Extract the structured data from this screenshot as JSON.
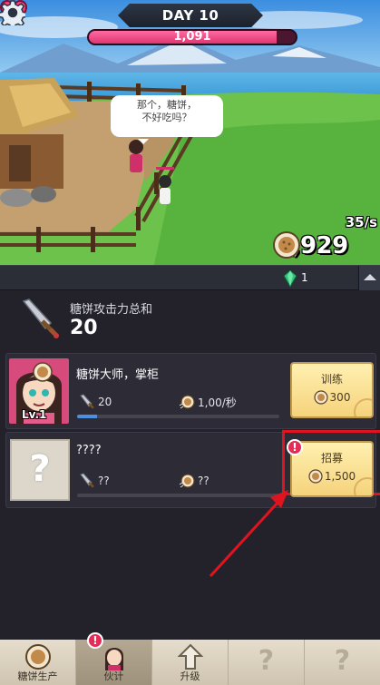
{
  "header": {
    "day": "DAY 10",
    "hp_value": "1,091",
    "hp_fraction": 0.91
  },
  "scene": {
    "speech": [
      "那个，糖饼，",
      "不好吃吗？"
    ],
    "rate": "35/s",
    "money": "3,929"
  },
  "gems": {
    "count": "1"
  },
  "total_attack": {
    "label": "糖饼攻击力总和",
    "value": "20"
  },
  "partners": [
    {
      "name": "糖饼大师，掌柜",
      "level": "Lv.1",
      "attack": "20",
      "rate": "1,00/秒",
      "progress": 0.1,
      "button_label": "训练",
      "button_cost": "300"
    },
    {
      "name": "????",
      "unknown_symbol": "?",
      "attack": "??",
      "rate": "??",
      "progress": 0,
      "button_label": "招募",
      "button_cost": "1,500",
      "alert": "!"
    }
  ],
  "nav": {
    "tabs": [
      {
        "label": "糖饼生产",
        "icon": "cake-icon"
      },
      {
        "label": "伙计",
        "icon": "partner-icon",
        "alert": "!"
      },
      {
        "label": "升级",
        "icon": "upgrade-arrow-icon"
      },
      {
        "label": "",
        "icon": "locked-icon",
        "symbol": "?"
      },
      {
        "label": "",
        "icon": "locked-icon",
        "symbol": "?"
      }
    ]
  },
  "colors": {
    "hp_fill": "#e03672",
    "progress": "#4c8fe0",
    "button": "#f5d37c",
    "highlight": "#e0141e",
    "gem": "#2fc27a"
  }
}
